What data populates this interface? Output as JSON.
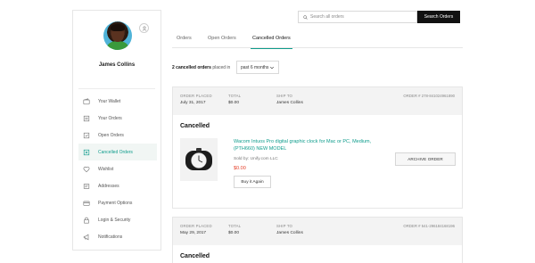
{
  "user": {
    "name": "James Collins"
  },
  "sidebar": {
    "items": [
      {
        "label": "Your Wallet",
        "icon": "wallet-icon"
      },
      {
        "label": "Your Orders",
        "icon": "orders-icon"
      },
      {
        "label": "Open Orders",
        "icon": "open-orders-icon"
      },
      {
        "label": "Cancelled Orders",
        "icon": "cancelled-orders-icon",
        "active": true
      },
      {
        "label": "Wishlist",
        "icon": "heart-icon"
      },
      {
        "label": "Addresses",
        "icon": "address-icon"
      },
      {
        "label": "Payment Options",
        "icon": "credit-card-icon"
      },
      {
        "label": "Login & Security",
        "icon": "lock-icon"
      },
      {
        "label": "Notifications",
        "icon": "megaphone-icon"
      }
    ]
  },
  "search": {
    "placeholder": "Search all orders",
    "button_label": "Search Orders"
  },
  "tabs": [
    {
      "label": "Orders"
    },
    {
      "label": "Open Orders"
    },
    {
      "label": "Cancelled Orders",
      "active": true
    }
  ],
  "filter": {
    "count_text": "2 cancelled orders",
    "suffix": "placed in",
    "period": "past 6 months"
  },
  "orders": [
    {
      "placed_label": "ORDER PLACED",
      "placed": "July 31, 2017",
      "total_label": "TOTAL",
      "total": "$0.00",
      "ship_label": "SHIP TO",
      "ship_to": "James Collins",
      "order_number": "ORDER # 278-841024961890",
      "status": "Cancelled",
      "product_title": "Wacom Intuos Pro digital graphic clock for Mac or PC, Medium, (PTH660) NEW MODEL",
      "sold_by": "Sold by: Unify.com LLC",
      "price": "$0.00",
      "buy_again": "Buy it Again",
      "archive": "ARCHIVE ORDER"
    },
    {
      "placed_label": "ORDER PLACED",
      "placed": "May 29, 2017",
      "total_label": "TOTAL",
      "total": "$0.00",
      "ship_label": "SHIP TO",
      "ship_to": "James Collins",
      "order_number": "ORDER # 541-296184168196",
      "status": "Cancelled"
    }
  ],
  "colors": {
    "accent": "#0e9c8c",
    "price": "#e5402a",
    "button_dark": "#111111"
  }
}
